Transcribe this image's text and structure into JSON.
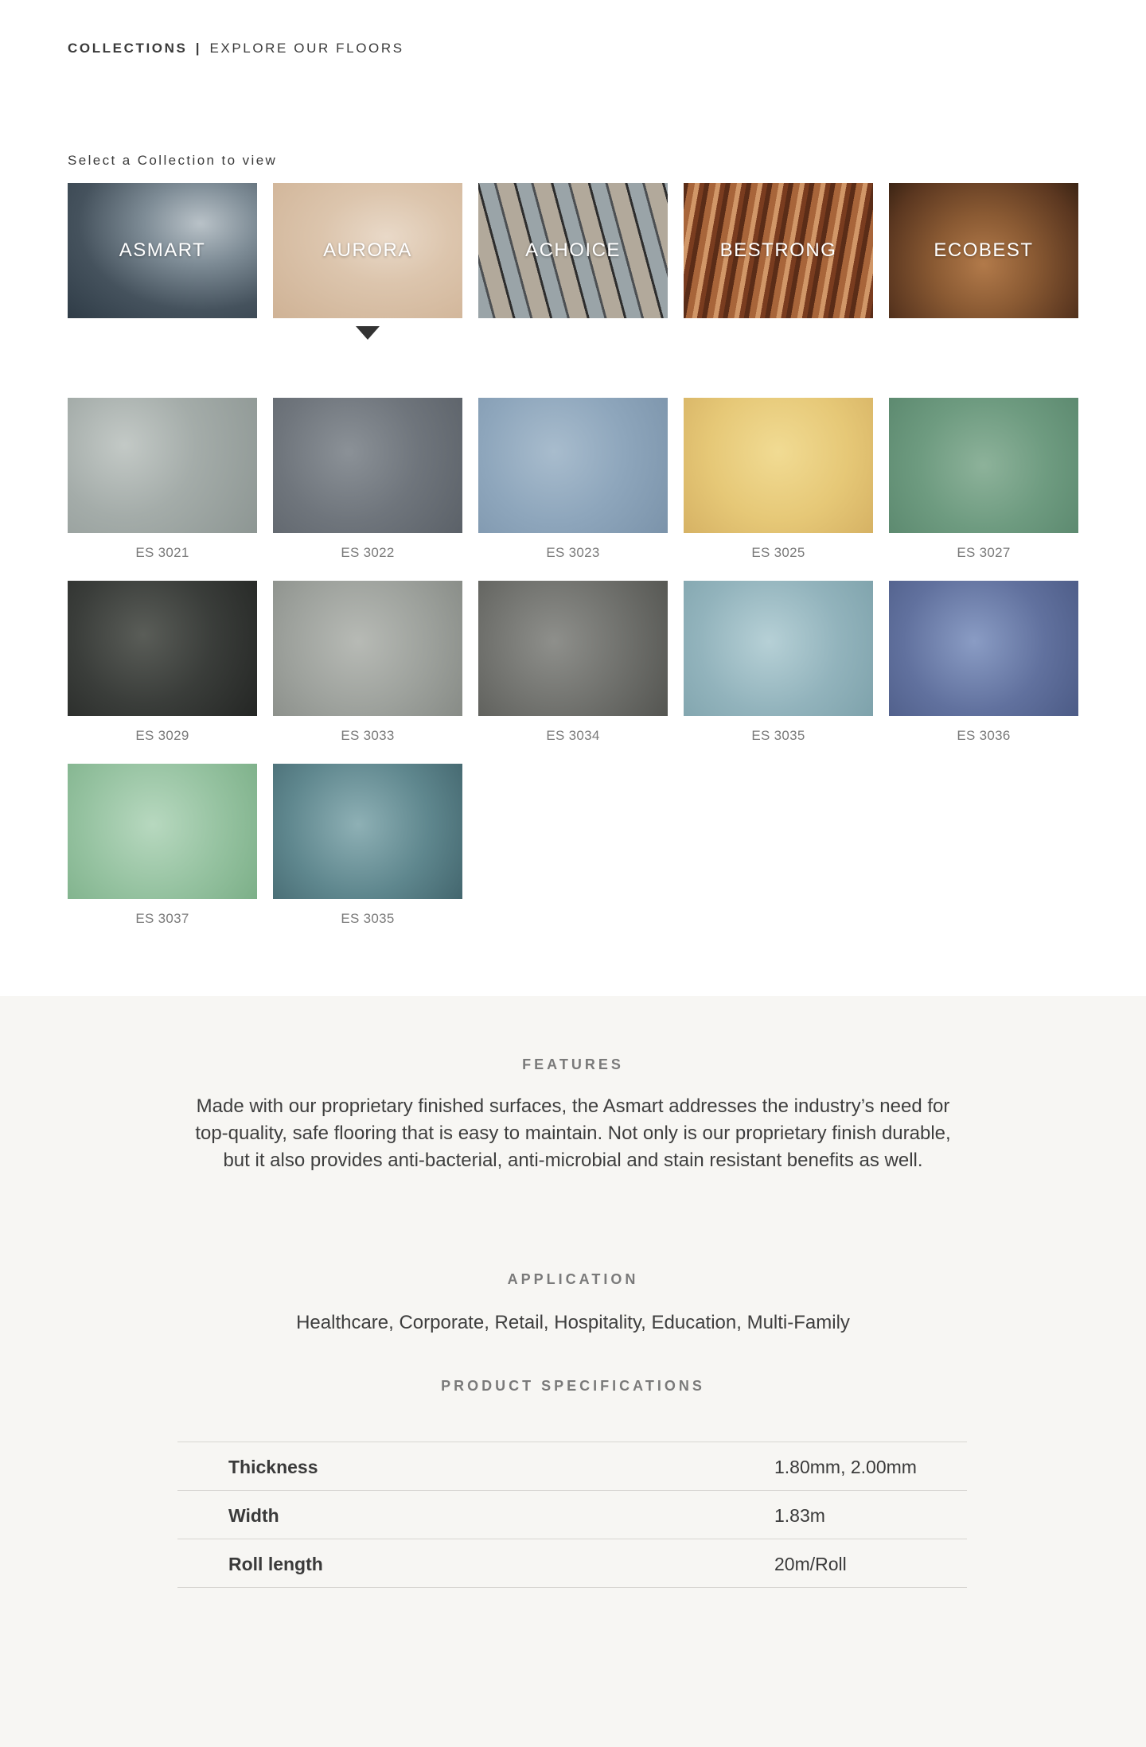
{
  "header": {
    "collections_label": "COLLECTIONS",
    "separator": "|",
    "subtitle": "EXPLORE OUR FLOORS"
  },
  "select_label": "Select a Collection to view",
  "collections": [
    {
      "name": "ASMART"
    },
    {
      "name": "AURORA"
    },
    {
      "name": "ACHOICE"
    },
    {
      "name": "BESTRONG"
    },
    {
      "name": "ECOBEST"
    }
  ],
  "swatches": [
    {
      "code": "ES 3021"
    },
    {
      "code": "ES 3022"
    },
    {
      "code": "ES 3023"
    },
    {
      "code": "ES 3025"
    },
    {
      "code": "ES 3027"
    },
    {
      "code": "ES 3029"
    },
    {
      "code": "ES 3033"
    },
    {
      "code": "ES 3034"
    },
    {
      "code": "ES 3035"
    },
    {
      "code": "ES 3036"
    },
    {
      "code": "ES 3037"
    },
    {
      "code": "ES 3035"
    }
  ],
  "features": {
    "title": "FEATURES",
    "text": "Made with our proprietary finished surfaces, the Asmart addresses the industry’s need for top-quality, safe flooring that is easy to maintain. Not only is our proprietary finish durable, but it also provides anti-bacterial, anti-microbial and stain resistant benefits as well."
  },
  "application": {
    "title": "APPLICATION",
    "text": "Healthcare, Corporate, Retail, Hospitality, Education, Multi-Family"
  },
  "specs": {
    "title": "PRODUCT SPECIFICATIONS",
    "rows": [
      {
        "key": "Thickness",
        "value": "1.80mm, 2.00mm"
      },
      {
        "key": "Width",
        "value": "1.83m"
      },
      {
        "key": "Roll length",
        "value": "20m/Roll"
      }
    ]
  }
}
